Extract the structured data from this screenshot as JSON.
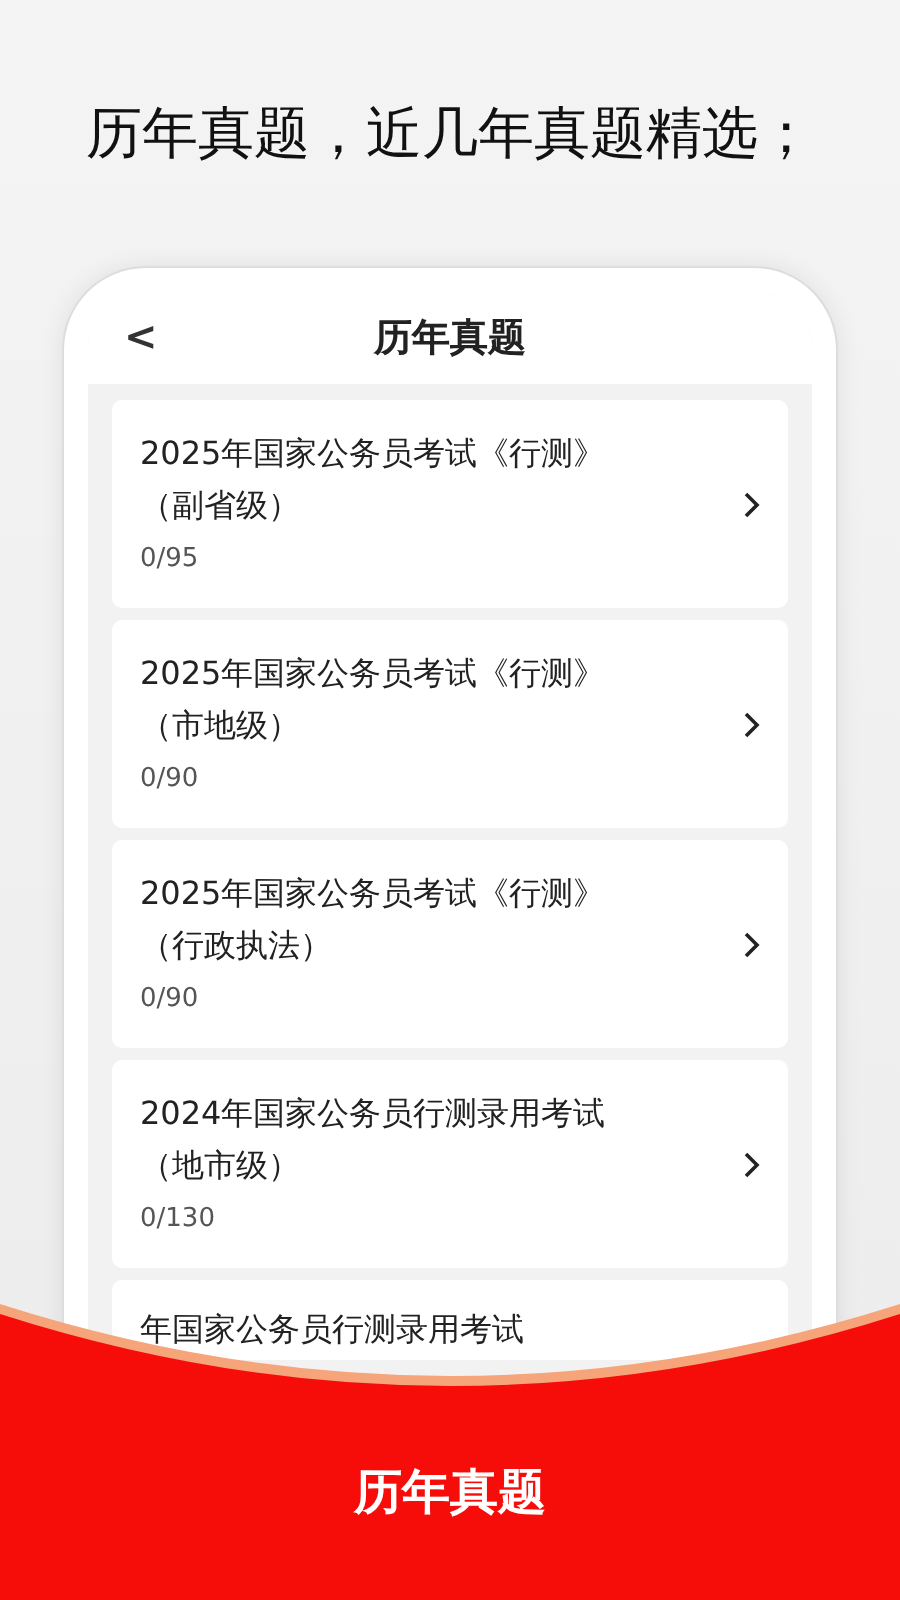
{
  "headline": "历年真题，近几年真题精选；",
  "screen": {
    "title": "历年真题",
    "back": "<",
    "items": [
      {
        "title": "2025年国家公务员考试《行测》",
        "subtitle": "（副省级）",
        "progress": "0/95"
      },
      {
        "title": "2025年国家公务员考试《行测》",
        "subtitle": "（市地级）",
        "progress": "0/90"
      },
      {
        "title": "2025年国家公务员考试《行测》",
        "subtitle": "（行政执法）",
        "progress": "0/90"
      },
      {
        "title": "2024年国家公务员行测录用考试",
        "subtitle": "（地市级）",
        "progress": "0/130"
      },
      {
        "title": "年国家公务员行测录用考试"
      }
    ]
  },
  "banner": {
    "title": "历年真题"
  }
}
